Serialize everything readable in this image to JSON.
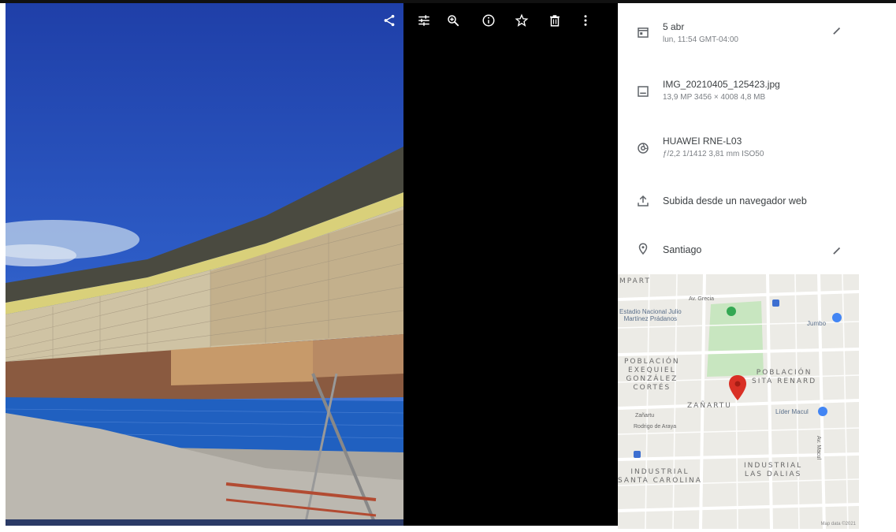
{
  "toolbar": {
    "icons": [
      "share-icon",
      "adjust-icon",
      "zoom-icon",
      "info-icon",
      "star-icon",
      "delete-icon",
      "more-vert-icon"
    ]
  },
  "info": {
    "date": {
      "title": "5 abr",
      "subtitle": "lun, 11:54   GMT-04:00",
      "icon": "calendar-icon"
    },
    "file": {
      "title": "IMG_20210405_125423.jpg",
      "subtitle": "13,9 MP   3456 × 4008   4,8 MB",
      "icon": "image-icon"
    },
    "camera": {
      "title": "HUAWEI RNE-L03",
      "subtitle": "ƒ/2,2   1/1412   3,81 mm   ISO50",
      "icon": "camera-icon"
    },
    "upload": {
      "title": "Subida desde un navegador web",
      "icon": "upload-icon"
    },
    "location": {
      "title": "Santiago",
      "icon": "location-pin-icon"
    }
  },
  "map": {
    "labels": {
      "top_left": "MPART",
      "poblacion_exequiel": "POBLACIÓN\nEXEQUIEL\nGONZÁLEZ\nCORTÉS",
      "poblacion_sita": "POBLACIÓN\nSITA RENARD",
      "zanartu": "ZAÑARTU",
      "industrial_santa": "INDUSTRIAL\nSANTA CAROLINA",
      "industrial_dalias": "INDUSTRIAL\nLAS DALIAS"
    },
    "pois": {
      "estadio": "Estadio Nacional Julio\nMartínez Prádanos",
      "jumbo": "Jumbo",
      "lider": "Líder Macul"
    },
    "streets": {
      "av_grecia": "Av. Grecia",
      "zanartu_street": "Zañartu",
      "rodrigo_araya": "Rodrigo de Araya",
      "av_macul": "Av. Macul"
    },
    "attribution": "Map data ©2021",
    "colors": {
      "park": "#c8e6c0",
      "pin": "#d93025",
      "poi": "#1a73e8"
    }
  }
}
